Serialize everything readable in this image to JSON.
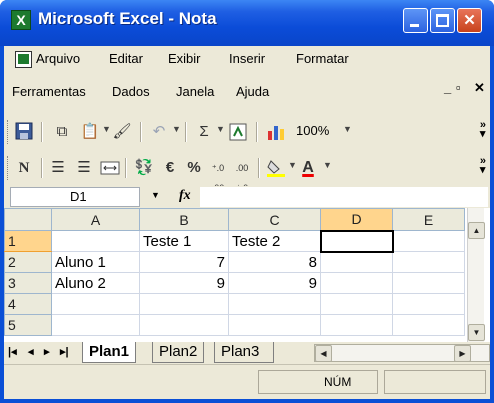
{
  "window": {
    "title": "Microsoft Excel - Nota",
    "app_icon": "excel-icon"
  },
  "menu": {
    "items": [
      "Arquivo",
      "Editar",
      "Exibir",
      "Inserir",
      "Formatar",
      "Ferramentas",
      "Dados",
      "Janela",
      "Ajuda"
    ]
  },
  "toolbar_standard": {
    "zoom": "100%"
  },
  "toolbar_format": {
    "currency_symbol": "€",
    "percent_symbol": "%",
    "font_color_letter": "A",
    "bold_letter": "N"
  },
  "formula_bar": {
    "name_box": "D1",
    "fx_label": "fx",
    "content": ""
  },
  "grid": {
    "columns": [
      "A",
      "B",
      "C",
      "D",
      "E"
    ],
    "rows": [
      {
        "num": "1",
        "cells": [
          "",
          "Teste 1",
          "Teste 2",
          "",
          ""
        ]
      },
      {
        "num": "2",
        "cells": [
          "Aluno 1",
          "7",
          "8",
          "",
          ""
        ]
      },
      {
        "num": "3",
        "cells": [
          "Aluno 2",
          "9",
          "9",
          "",
          ""
        ]
      },
      {
        "num": "4",
        "cells": [
          "",
          "",
          "",
          "",
          ""
        ]
      },
      {
        "num": "5",
        "cells": [
          "",
          "",
          "",
          "",
          ""
        ]
      }
    ],
    "selected_cell": "D1"
  },
  "sheet_tabs": [
    "Plan1",
    "Plan2",
    "Plan3"
  ],
  "status_bar": {
    "num_lock": "NÚM"
  },
  "colors": {
    "title_bar": "#0b4cd8",
    "chrome": "#ece9d8",
    "active_header": "#ffd58d"
  }
}
